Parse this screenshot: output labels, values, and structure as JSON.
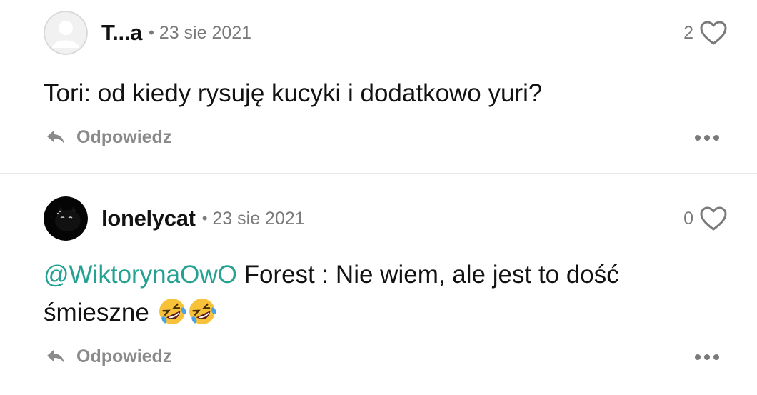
{
  "comments": [
    {
      "username": "T...a",
      "separator": "•",
      "date": "23 sie 2021",
      "like_count": "2",
      "text": "Tori: od kiedy rysuję kucyki i dodatkowo yuri?",
      "reply_label": "Odpowiedz",
      "avatar_icon": "default-user-avatar"
    },
    {
      "username": "lonelycat",
      "separator": "•",
      "date": "23 sie 2021",
      "like_count": "0",
      "mention": "@WiktorynaOwO",
      "text": " Forest : Nie wiem, ale jest to dość śmieszne",
      "emoji": [
        "rolling-on-floor-laughing",
        "rolling-on-floor-laughing"
      ],
      "reply_label": "Odpowiedz",
      "avatar_icon": "black-cat-avatar"
    }
  ],
  "colors": {
    "mention": "#24a192",
    "muted": "#7a7a7a",
    "text": "#121212",
    "divider": "#e8e8e8"
  }
}
